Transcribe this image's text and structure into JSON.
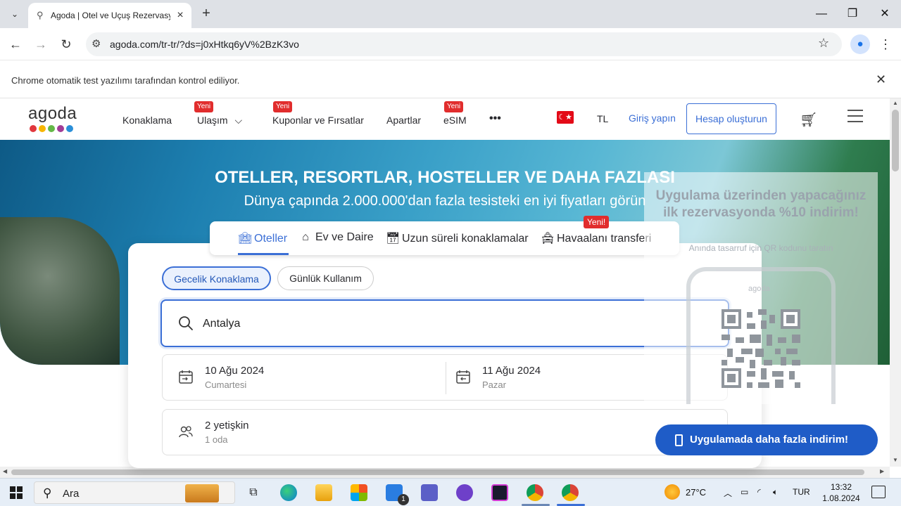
{
  "browser": {
    "tab_title": "Agoda | Otel ve Uçuş Rezervasy",
    "url": "agoda.com/tr-tr/?ds=j0xHtkq6yV%2BzK3vo",
    "infobar_text": "Chrome otomatik test yazılımı tarafından kontrol ediliyor."
  },
  "site": {
    "logo": "agoda",
    "nav": [
      {
        "label": "Konaklama",
        "badge": ""
      },
      {
        "label": "Ulaşım",
        "badge": "Yeni"
      },
      {
        "label": "Kuponlar ve Fırsatlar",
        "badge": "Yeni"
      },
      {
        "label": "Apartlar",
        "badge": ""
      },
      {
        "label": "eSIM",
        "badge": "Yeni"
      }
    ],
    "more": "•••",
    "currency": "TL",
    "signin": "Giriş yapın",
    "create_account": "Hesap oluşturun"
  },
  "hero": {
    "title": "OTELLER, RESORTLAR, HOSTELLER VE DAHA FAZLASI",
    "subtitle": "Dünya çapında 2.000.000'dan fazla tesisteki en iyi fiyatları görün"
  },
  "search_tabs": [
    {
      "label": "Oteller",
      "active": true
    },
    {
      "label": "Ev ve Daire",
      "active": false
    },
    {
      "label": "Uzun süreli konaklamalar",
      "active": false
    },
    {
      "label": "Havaalanı transferi",
      "active": false,
      "badge": "Yeni!"
    }
  ],
  "search": {
    "mode_overnight": "Gecelik Konaklama",
    "mode_day": "Günlük Kullanım",
    "destination": "Antalya",
    "checkin_date": "10 Ağu 2024",
    "checkin_day": "Cumartesi",
    "checkout_date": "11 Ağu 2024",
    "checkout_day": "Pazar",
    "guests": "2 yetişkin",
    "rooms": "1 oda"
  },
  "qr_promo": {
    "title": "Uygulama üzerinden yapacağınız ilk rezervasyonda %10 indirim!",
    "subtitle": "Anında tasarruf için QR kodunu taratın",
    "phone_logo": "agoda"
  },
  "app_button": "Uygulamada daha fazla indirim!",
  "taskbar": {
    "search_label": "Ara",
    "weather": "27°C",
    "lang": "TUR",
    "time": "13:32",
    "date": "1.08.2024",
    "mail_badge": "1"
  },
  "colors": {
    "brand_blue": "#3b6fd6",
    "badge_red": "#e12d2d",
    "promo_blue": "#1f5cc7"
  }
}
